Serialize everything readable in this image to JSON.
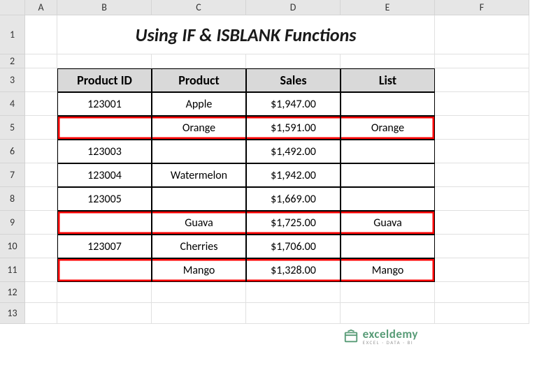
{
  "columns": [
    "A",
    "B",
    "C",
    "D",
    "E",
    "F"
  ],
  "rows": [
    "1",
    "2",
    "3",
    "4",
    "5",
    "6",
    "7",
    "8",
    "9",
    "10",
    "11",
    "12",
    "13"
  ],
  "title": "Using IF & ISBLANK Functions",
  "headers": {
    "b": "Product ID",
    "c": "Product",
    "d": "Sales",
    "e": "List"
  },
  "data": [
    {
      "id": "123001",
      "product": "Apple",
      "sales": "$1,947.00",
      "list": "",
      "hl": false
    },
    {
      "id": "",
      "product": "Orange",
      "sales": "$1,591.00",
      "list": "Orange",
      "hl": true
    },
    {
      "id": "123003",
      "product": "",
      "sales": "$1,492.00",
      "list": "",
      "hl": false
    },
    {
      "id": "123004",
      "product": "Watermelon",
      "sales": "$1,942.00",
      "list": "",
      "hl": false
    },
    {
      "id": "123005",
      "product": "",
      "sales": "$1,669.00",
      "list": "",
      "hl": false
    },
    {
      "id": "",
      "product": "Guava",
      "sales": "$1,725.00",
      "list": "Guava",
      "hl": true
    },
    {
      "id": "123007",
      "product": "Cherries",
      "sales": "$1,706.00",
      "list": "",
      "hl": false
    },
    {
      "id": "",
      "product": "Mango",
      "sales": "$1,328.00",
      "list": "Mango",
      "hl": true
    }
  ],
  "watermark": {
    "main": "exceldemy",
    "sub": "EXCEL · DATA · BI"
  },
  "chart_data": {
    "type": "table",
    "title": "Using IF & ISBLANK Functions",
    "columns": [
      "Product ID",
      "Product",
      "Sales",
      "List"
    ],
    "rows": [
      [
        "123001",
        "Apple",
        1947.0,
        ""
      ],
      [
        "",
        "Orange",
        1591.0,
        "Orange"
      ],
      [
        "123003",
        "",
        1492.0,
        ""
      ],
      [
        "123004",
        "Watermelon",
        1942.0,
        ""
      ],
      [
        "123005",
        "",
        1669.0,
        ""
      ],
      [
        "",
        "Guava",
        1725.0,
        "Guava"
      ],
      [
        "123007",
        "Cherries",
        1706.0,
        ""
      ],
      [
        "",
        "Mango",
        1328.0,
        "Mango"
      ]
    ]
  }
}
